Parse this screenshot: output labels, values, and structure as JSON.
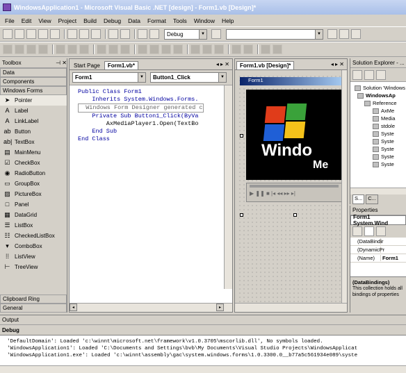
{
  "window": {
    "title": "WindowsApplication1 - Microsoft Visual Basic .NET [design] - Form1.vb [Design]*"
  },
  "menu": [
    "File",
    "Edit",
    "View",
    "Project",
    "Build",
    "Debug",
    "Data",
    "Format",
    "Tools",
    "Window",
    "Help"
  ],
  "toolbar": {
    "config_value": "Debug"
  },
  "toolbox": {
    "title": "Toolbox",
    "tabs_top": [
      "Data",
      "Components",
      "Windows Forms"
    ],
    "items": [
      {
        "icon": "pointer-icon",
        "glyph": "➤",
        "label": "Pointer"
      },
      {
        "icon": "label-icon",
        "glyph": "A",
        "label": "Label"
      },
      {
        "icon": "linklabel-icon",
        "glyph": "A",
        "label": "LinkLabel"
      },
      {
        "icon": "button-icon",
        "glyph": "ab",
        "label": "Button"
      },
      {
        "icon": "textbox-icon",
        "glyph": "ab|",
        "label": "TextBox"
      },
      {
        "icon": "mainmenu-icon",
        "glyph": "▤",
        "label": "MainMenu"
      },
      {
        "icon": "checkbox-icon",
        "glyph": "☑",
        "label": "CheckBox"
      },
      {
        "icon": "radiobutton-icon",
        "glyph": "◉",
        "label": "RadioButton"
      },
      {
        "icon": "groupbox-icon",
        "glyph": "▭",
        "label": "GroupBox"
      },
      {
        "icon": "picturebox-icon",
        "glyph": "▨",
        "label": "PictureBox"
      },
      {
        "icon": "panel-icon",
        "glyph": "□",
        "label": "Panel"
      },
      {
        "icon": "datagrid-icon",
        "glyph": "▦",
        "label": "DataGrid"
      },
      {
        "icon": "listbox-icon",
        "glyph": "☰",
        "label": "ListBox"
      },
      {
        "icon": "checkedlistbox-icon",
        "glyph": "☷",
        "label": "CheckedListBox"
      },
      {
        "icon": "combobox-icon",
        "glyph": "▾",
        "label": "ComboBox"
      },
      {
        "icon": "listview-icon",
        "glyph": "⁞⁞",
        "label": "ListView"
      },
      {
        "icon": "treeview-icon",
        "glyph": "⊢",
        "label": "TreeView"
      }
    ],
    "tabs_bottom": [
      "Clipboard Ring",
      "General"
    ]
  },
  "editor": {
    "tabs": [
      "Start Page",
      "Form1.vb*"
    ],
    "class_combo": "Form1",
    "method_combo": "Button1_Click",
    "lines": [
      "Public Class Form1",
      "    Inherits System.Windows.Forms.",
      "",
      "  Windows Form Designer generated c",
      "",
      "    Private Sub Button1_Click(ByVa",
      "        AxMediaPlayer1.Open(TextBo",
      "    End Sub",
      "End Class"
    ]
  },
  "designer": {
    "tab": "Form1.vb [Design]*",
    "form_title": "Form1",
    "media_text1": "Windo",
    "media_text2": "Me"
  },
  "solution": {
    "title": "Solution Explorer - ...",
    "items": [
      "Solution 'Windows",
      "WindowsAp",
      "Reference",
      "AxMe",
      "Media",
      "stdole",
      "Syste",
      "Syste",
      "Syste",
      "Syste",
      "Syste"
    ],
    "tabs": [
      "S...",
      "C..."
    ]
  },
  "properties": {
    "title": "Properties",
    "object": "Form1  System.Wind",
    "rows": [
      [
        "(DataBindir",
        ""
      ],
      [
        "(DynamicPr",
        ""
      ],
      [
        "(Name)",
        "Form1"
      ]
    ],
    "desc_title": "(DataBindings)",
    "desc_text": "This collection holds all bindings of properties"
  },
  "output": {
    "title": "Output",
    "pane": "Debug",
    "lines": [
      "'DefaultDomain': Loaded 'c:\\winnt\\microsoft.net\\framework\\v1.0.3705\\mscorlib.dll', No symbols loaded.",
      "'WindowsApplication1': Loaded 'C:\\Documents and Settings\\bvb\\My Documents\\Visual Studio Projects\\WindowsApplicat",
      "'WindowsApplication1.exe': Loaded 'c:\\winnt\\assembly\\gac\\system.windows.forms\\1.0.3300.0__b77a5c561934e089\\syste"
    ]
  },
  "colors": {
    "media_bg": "#000000",
    "title_bar": "#a9bfe8"
  }
}
